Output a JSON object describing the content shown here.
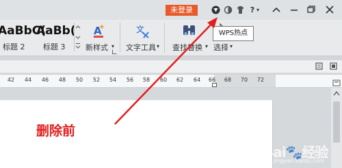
{
  "titlebar": {
    "login_label": "未登录",
    "icons": [
      "hotspot-icon",
      "skin-icon",
      "shirt-icon",
      "help-icon",
      "minimize-ribbon-icon",
      "minimize-icon",
      "restore-icon",
      "close-icon"
    ],
    "help_label": "?",
    "help_dropdown": "▾"
  },
  "ribbon": {
    "styles": [
      {
        "sample": "AaBbC(",
        "name": "标题 2"
      },
      {
        "sample": "AaBb(",
        "name": "标题 3"
      }
    ],
    "new_style_label": "新样式",
    "text_tools_label": "文字工具",
    "find_replace_label": "查找替换",
    "select_label": "选择",
    "dropdown_glyph": "▾"
  },
  "tooltip": {
    "text": "WPS热点"
  },
  "ruler": {
    "ticks": [
      "42",
      "44",
      "46",
      "48",
      "50",
      "52",
      "54",
      "56",
      "58",
      "60",
      "62",
      "64",
      "66",
      "68",
      "70",
      "72"
    ]
  },
  "annotation": {
    "text": "删除前"
  },
  "colors": {
    "login_bg": "#e75a2b",
    "annotation": "#e31d1d",
    "arrow": "#e31d1d"
  }
}
